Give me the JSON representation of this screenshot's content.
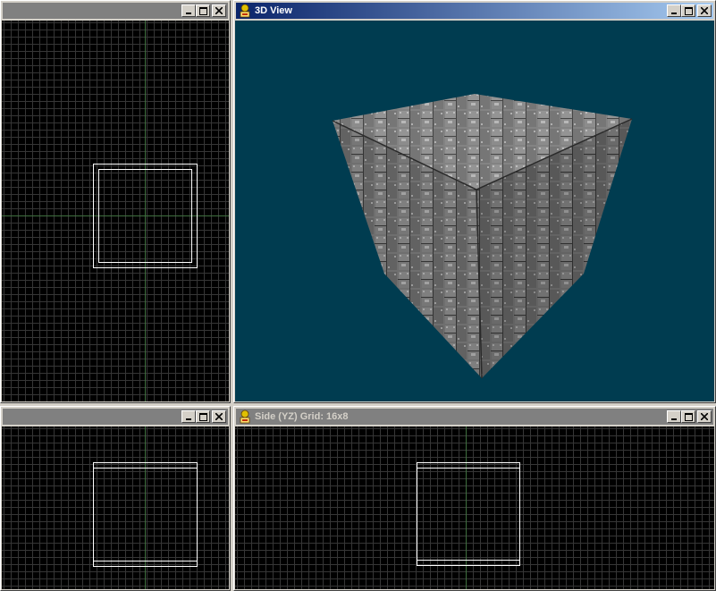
{
  "windows": {
    "top_left": {
      "title": "",
      "active": false
    },
    "view3d": {
      "title": "3D View",
      "active": true
    },
    "bottom_left": {
      "title": "",
      "active": false
    },
    "side": {
      "title": "Side (YZ) Grid: 16x8",
      "active": false
    }
  },
  "title_buttons": {
    "minimize": "minimize-icon",
    "maximize": "maximize-icon",
    "close": "close-icon"
  },
  "colors": {
    "viewport_3d_bg": "#003c50",
    "grid_bg": "#000000",
    "grid_line": "#363636",
    "axis_line": "#3f6f3f",
    "brush_outline": "#ffffff",
    "active_title": "#0a246a"
  }
}
